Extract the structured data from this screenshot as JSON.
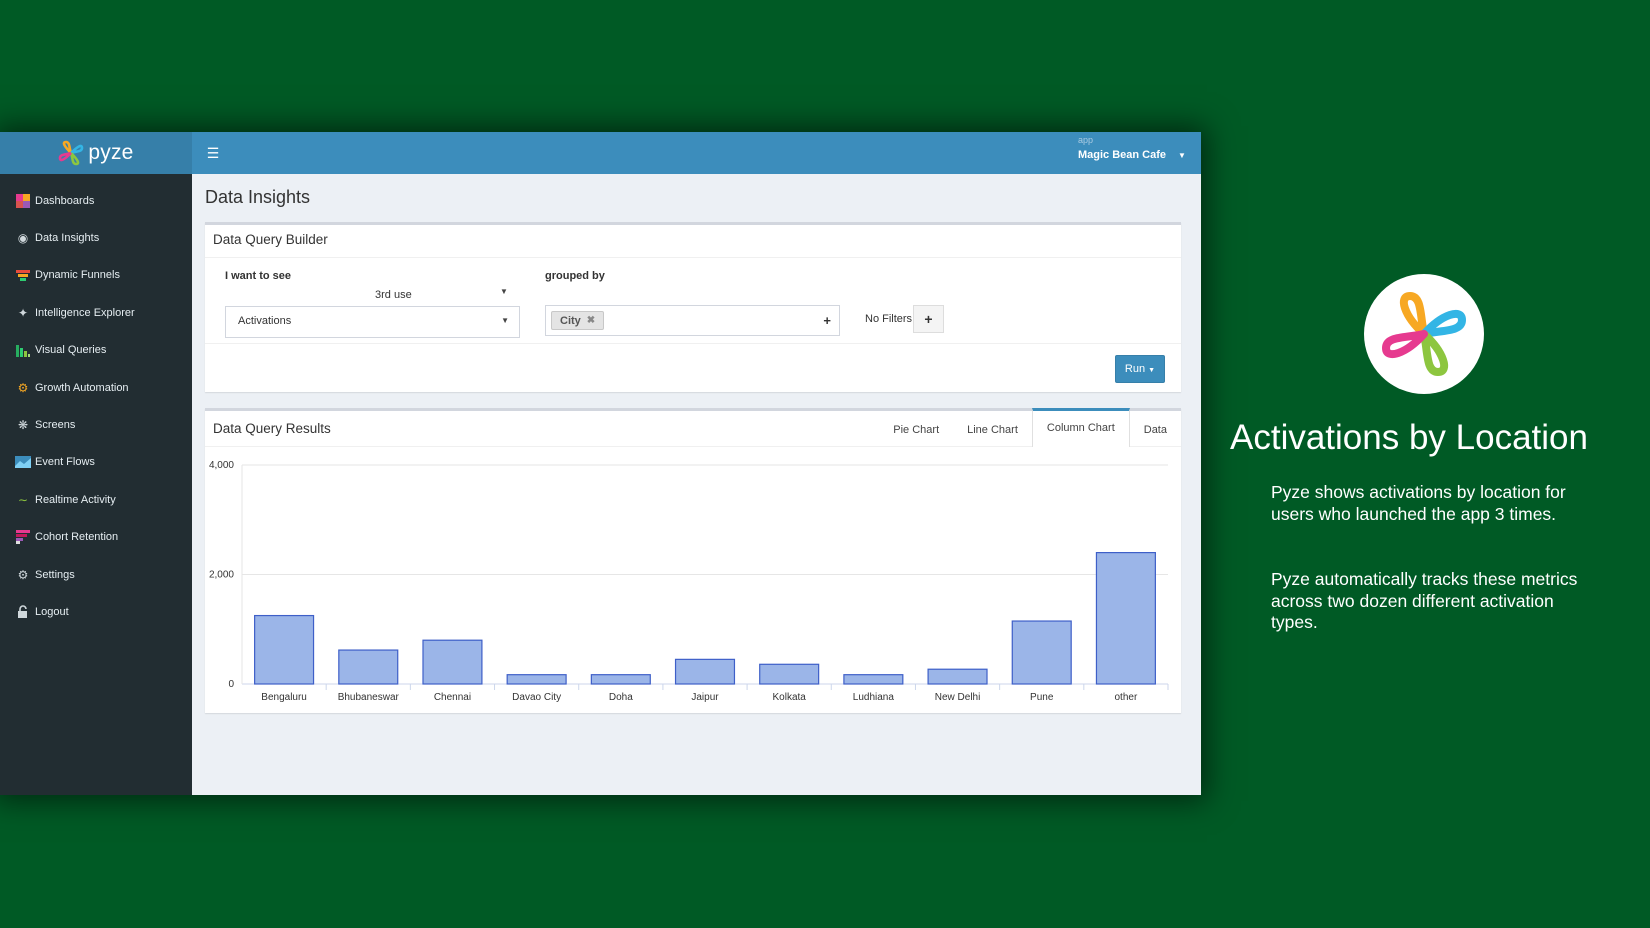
{
  "header": {
    "brand": "pyze",
    "app_label": "app",
    "app_name": "Magic Bean Cafe"
  },
  "sidebar": {
    "items": [
      {
        "label": "Dashboards",
        "icon": "dashboard-icon"
      },
      {
        "label": "Data Insights",
        "icon": "insights-icon"
      },
      {
        "label": "Dynamic Funnels",
        "icon": "funnel-icon"
      },
      {
        "label": "Intelligence Explorer",
        "icon": "explorer-icon"
      },
      {
        "label": "Visual Queries",
        "icon": "visual-queries-icon"
      },
      {
        "label": "Growth Automation",
        "icon": "gears-icon"
      },
      {
        "label": "Screens",
        "icon": "screens-icon"
      },
      {
        "label": "Event Flows",
        "icon": "event-flows-icon"
      },
      {
        "label": "Realtime Activity",
        "icon": "realtime-icon"
      },
      {
        "label": "Cohort Retention",
        "icon": "cohort-icon"
      },
      {
        "label": "Settings",
        "icon": "gear-icon"
      },
      {
        "label": "Logout",
        "icon": "unlock-icon"
      }
    ]
  },
  "page": {
    "title": "Data Insights"
  },
  "builder": {
    "title": "Data Query Builder",
    "want_label": "I want to see",
    "use_select": "3rd use",
    "metric_select": "Activations",
    "grouped_label": "grouped by",
    "group_tag": "City",
    "filters_text": "No Filters",
    "run_label": "Run"
  },
  "results": {
    "title": "Data Query Results",
    "tabs": [
      "Pie Chart",
      "Line Chart",
      "Column Chart",
      "Data"
    ],
    "active_tab": "Column Chart"
  },
  "chart_data": {
    "type": "bar",
    "categories": [
      "Bengaluru",
      "Bhubaneswar",
      "Chennai",
      "Davao City",
      "Doha",
      "Jaipur",
      "Kolkata",
      "Ludhiana",
      "New Delhi",
      "Pune",
      "other"
    ],
    "values": [
      1250,
      620,
      800,
      170,
      170,
      450,
      360,
      170,
      270,
      1150,
      2400
    ],
    "ylim": [
      0,
      4000
    ],
    "yticks": [
      0,
      2000,
      4000
    ],
    "ytick_labels": [
      "0",
      "2,000",
      "4,000"
    ],
    "bar_color": "#9bb5e8",
    "bar_stroke": "#3e5fc8",
    "grid": true
  },
  "promo": {
    "title": "Activations by Location",
    "paragraph1": "Pyze shows activations by location for users who launched the app 3 times.",
    "paragraph2": "Pyze automatically tracks these metrics across two dozen different activation types."
  },
  "colors": {
    "background": "#005a25",
    "topbar": "#3c8dbc",
    "sidebar": "#222d32",
    "run_button": "#3c8dbc"
  }
}
